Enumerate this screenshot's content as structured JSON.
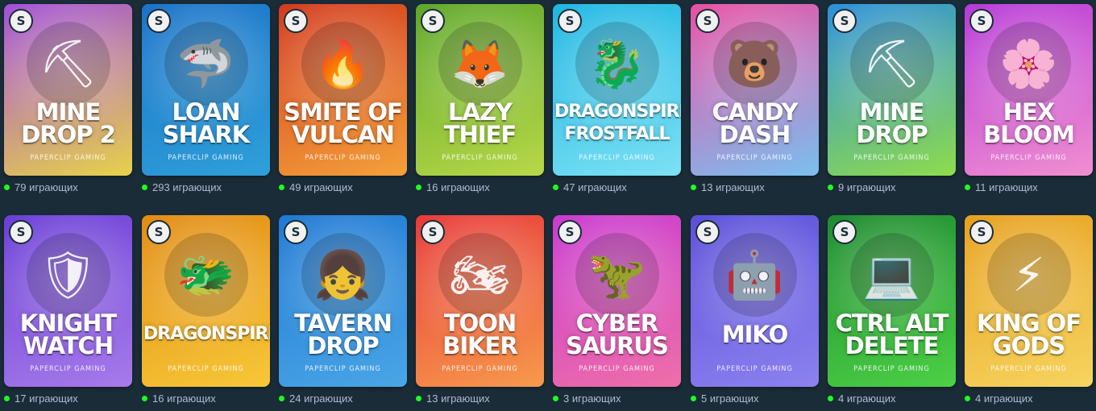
{
  "games": [
    {
      "title": "MINE DROP 2",
      "provider": "PAPERCLIP GAMING",
      "players": "79 играющих",
      "bg": [
        "#a24fd8",
        "#e7d24a"
      ],
      "icon": "⛏"
    },
    {
      "title": "LOAN SHARK",
      "provider": "PAPERCLIP GAMING",
      "players": "293 играющих",
      "bg": [
        "#1b73c8",
        "#2fa0d9"
      ],
      "icon": "🦈"
    },
    {
      "title": "SMITE OF VULCAN",
      "provider": "PAPERCLIP GAMING",
      "players": "49 играющих",
      "bg": [
        "#d33b1f",
        "#f4a13a"
      ],
      "icon": "🔥"
    },
    {
      "title": "LAZY THIEF",
      "provider": "PAPERCLIP GAMING",
      "players": "16 играющих",
      "bg": [
        "#5ea72a",
        "#b8d848"
      ],
      "icon": "🦊"
    },
    {
      "title": "DRAGONSPIRE FROSTFALL",
      "provider": "PAPERCLIP GAMING",
      "players": "47 играющих",
      "bg": [
        "#1db6e2",
        "#7de1f4"
      ],
      "icon": "🐉"
    },
    {
      "title": "CANDY DASH",
      "provider": "PAPERCLIP GAMING",
      "players": "13 играющих",
      "bg": [
        "#ea4fa4",
        "#7bc0ef"
      ],
      "icon": "🐻"
    },
    {
      "title": "MINE DROP",
      "provider": "PAPERCLIP GAMING",
      "players": "9 играющих",
      "bg": [
        "#2b8fdc",
        "#8fdc4c"
      ],
      "icon": "⛏"
    },
    {
      "title": "HEX BLOOM",
      "provider": "PAPERCLIP GAMING",
      "players": "11 играющих",
      "bg": [
        "#b63ad8",
        "#f18fd0"
      ],
      "icon": "🌸"
    },
    {
      "title": "KNIGHT WATCH",
      "provider": "PAPERCLIP GAMING",
      "players": "17 играющих",
      "bg": [
        "#6a3fd6",
        "#a77bea"
      ],
      "icon": "🛡"
    },
    {
      "title": "DRAGONSPIRE",
      "provider": "PAPERCLIP GAMING",
      "players": "16 играющих",
      "bg": [
        "#e28b14",
        "#f7c838"
      ],
      "icon": "🐲"
    },
    {
      "title": "TAVERN DROP",
      "provider": "PAPERCLIP GAMING",
      "players": "24 играющих",
      "bg": [
        "#2079d3",
        "#4aa6e6"
      ],
      "icon": "👧"
    },
    {
      "title": "TOON BIKER",
      "provider": "PAPERCLIP GAMING",
      "players": "13 играющих",
      "bg": [
        "#e73a3a",
        "#f79a4c"
      ],
      "icon": "🏍"
    },
    {
      "title": "CYBER SAURUS",
      "provider": "PAPERCLIP GAMING",
      "players": "3 играющих",
      "bg": [
        "#c93ad1",
        "#ef6fa8"
      ],
      "icon": "🦖"
    },
    {
      "title": "MIKO",
      "provider": "PAPERCLIP GAMING",
      "players": "5 играющих",
      "bg": [
        "#5b4fd9",
        "#8d82ef"
      ],
      "icon": "🤖"
    },
    {
      "title": "CTRL ALT DELETE",
      "provider": "PAPERCLIP GAMING",
      "players": "4 играющих",
      "bg": [
        "#1e8a30",
        "#4dd146"
      ],
      "icon": "💻"
    },
    {
      "title": "KING OF GODS",
      "provider": "PAPERCLIP GAMING",
      "players": "4 играющих",
      "bg": [
        "#e7a01e",
        "#f6d560"
      ],
      "icon": "⚡"
    }
  ],
  "badge_glyph": "S",
  "status_color": "#1fff20"
}
